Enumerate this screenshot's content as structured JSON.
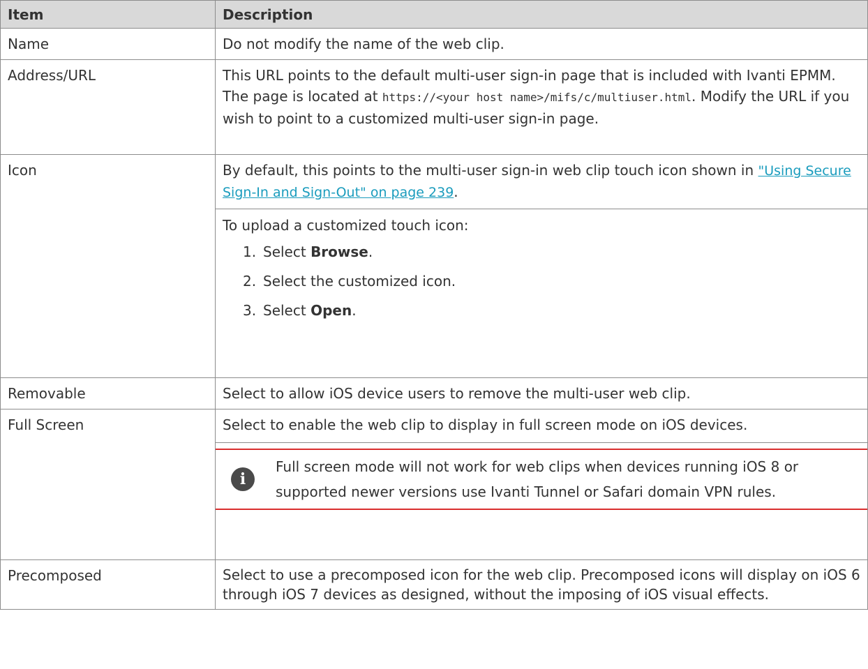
{
  "table": {
    "headers": {
      "item": "Item",
      "description": "Description"
    },
    "rows": {
      "name": {
        "item": "Name",
        "description": "Do not modify the name of the web clip."
      },
      "address": {
        "item": "Address/URL",
        "text_before": "This URL points to the default multi-user sign-in page that is included with Ivanti EPMM. The page is located at ",
        "code": "https://<your host name>/mifs/c/multiuser.html",
        "text_after": ". Modify the URL if you wish to point to a customized multi-user sign-in page."
      },
      "icon": {
        "item": "Icon",
        "text_before": "By default, this points to the multi-user sign-in web clip touch icon shown in ",
        "link": "\"Using Secure Sign-In and Sign-Out\" on page 239",
        "text_after": ".",
        "upload_intro": "To upload a customized touch icon:",
        "steps": [
          {
            "num": "1.",
            "text": "Select ",
            "bold": "Browse",
            "end": "."
          },
          {
            "num": "2.",
            "text": "Select the customized icon.",
            "bold": "",
            "end": ""
          },
          {
            "num": "3.",
            "text": "Select ",
            "bold": "Open",
            "end": "."
          }
        ]
      },
      "removable": {
        "item": "Removable",
        "description": "Select to allow iOS device users to remove the multi-user web clip."
      },
      "full_screen": {
        "item": "Full Screen",
        "description": "Select to enable the web clip to display in full screen mode on iOS devices.",
        "note": "Full screen mode will not work for web clips when devices running iOS 8 or supported newer versions use Ivanti Tunnel or Safari domain VPN rules.",
        "note_icon": "info-icon"
      },
      "precomposed": {
        "item": "Precomposed",
        "description": "Select to use a precomposed icon for the web clip. Precomposed icons will display on iOS 6 through iOS 7 devices as designed, without the imposing of iOS visual effects."
      }
    }
  },
  "colors": {
    "header_bg": "#d9d9d9",
    "border": "#8c8c8c",
    "link": "#1a9cbd",
    "note_rule": "#d92e2e",
    "text": "#333333"
  }
}
